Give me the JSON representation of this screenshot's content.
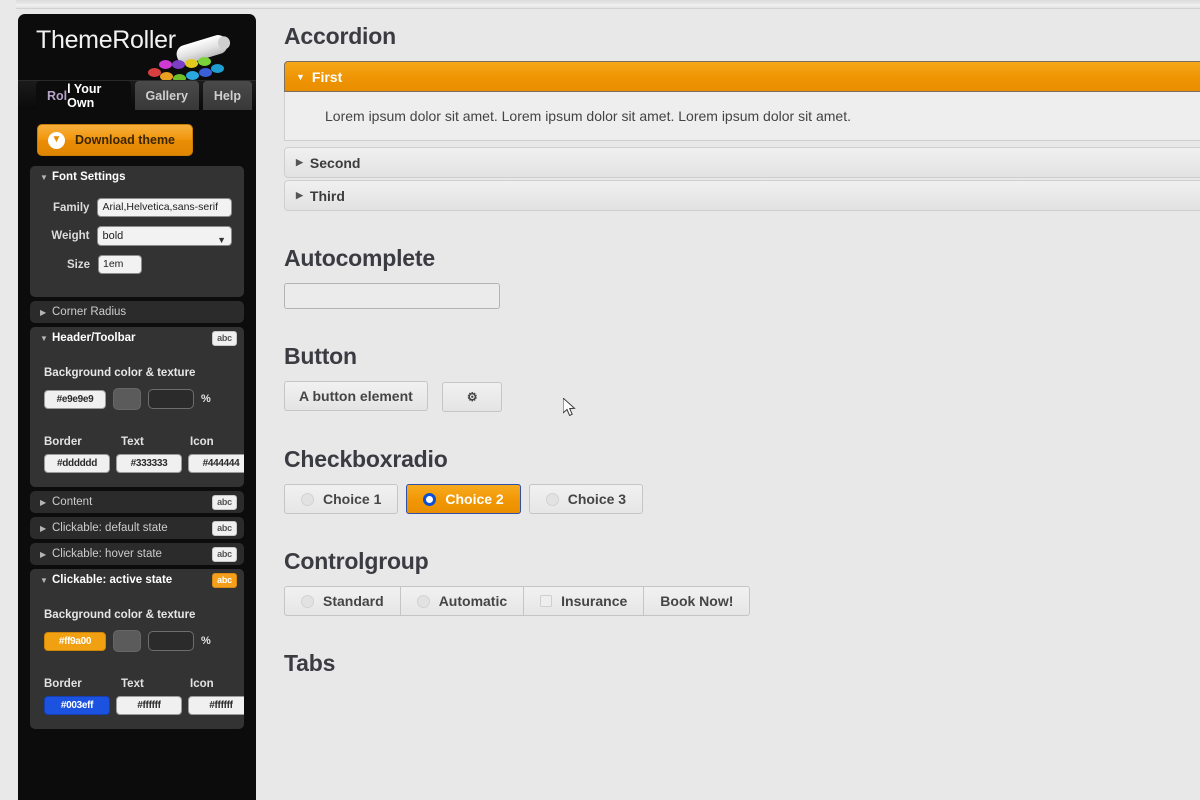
{
  "app": {
    "logo_text": "ThemeRoller",
    "logo_icon": "paint-roller-icon",
    "dot_colors": [
      "#d93f3f",
      "#e8a020",
      "#6fbf2a",
      "#7a3fc4",
      "#2aa8e0",
      "#e0c81e",
      "#3a5fd9",
      "#7ad13a",
      "#1f9fd1",
      "#cf3ad1"
    ]
  },
  "sidebar": {
    "tabs": [
      {
        "label": "Roll Your Own",
        "active": true
      },
      {
        "label": "Gallery",
        "active": false
      },
      {
        "label": "Help",
        "active": false
      }
    ],
    "download": {
      "label": "Download theme",
      "icon": "download-arrow-icon"
    },
    "font_settings": {
      "title": "Font Settings",
      "family_label": "Family",
      "family_value": "Arial,Helvetica,sans-serif",
      "weight_label": "Weight",
      "weight_value": "bold",
      "size_label": "Size",
      "size_value": "1em"
    },
    "corner_radius": {
      "title": "Corner Radius"
    },
    "header_toolbar": {
      "title": "Header/Toolbar",
      "badge": "abc",
      "bg_label": "Background color & texture",
      "bg_color": "#e9e9e9",
      "pct_value": "",
      "pct_sign": "%",
      "border_label": "Border",
      "text_label": "Text",
      "icon_label": "Icon",
      "border_color": "#dddddd",
      "text_color": "#333333",
      "icon_color": "#444444"
    },
    "content": {
      "title": "Content",
      "badge": "abc"
    },
    "clickable_default": {
      "title": "Clickable: default state",
      "badge": "abc"
    },
    "clickable_hover": {
      "title": "Clickable: hover state",
      "badge": "abc"
    },
    "clickable_active": {
      "title": "Clickable: active state",
      "badge": "abc",
      "bg_label": "Background color & texture",
      "bg_color": "#ff9a00",
      "pct_value": "",
      "pct_sign": "%",
      "border_label": "Border",
      "text_label": "Text",
      "icon_label": "Icon",
      "border_color": "#003eff",
      "text_color": "#ffffff",
      "icon_color": "#ffffff"
    }
  },
  "main": {
    "accordion": {
      "heading": "Accordion",
      "items": [
        {
          "label": "First",
          "active": true,
          "content": "Lorem ipsum dolor sit amet. Lorem ipsum dolor sit amet. Lorem ipsum dolor sit amet."
        },
        {
          "label": "Second",
          "active": false,
          "content": ""
        },
        {
          "label": "Third",
          "active": false,
          "content": ""
        }
      ]
    },
    "autocomplete": {
      "heading": "Autocomplete",
      "value": "",
      "placeholder": ""
    },
    "button": {
      "heading": "Button",
      "primary_label": "A button element",
      "icon_label": "⚙",
      "icon_name": "gear-icon"
    },
    "checkboxradio": {
      "heading": "Checkboxradio",
      "options": [
        {
          "label": "Choice 1",
          "checked": false
        },
        {
          "label": "Choice 2",
          "checked": true
        },
        {
          "label": "Choice 3",
          "checked": false
        }
      ]
    },
    "controlgroup": {
      "heading": "Controlgroup",
      "options": [
        {
          "label": "Standard",
          "type": "radio"
        },
        {
          "label": "Automatic",
          "type": "radio"
        },
        {
          "label": "Insurance",
          "type": "checkbox"
        },
        {
          "label": "Book Now!",
          "type": "button"
        }
      ]
    },
    "tabs": {
      "heading": "Tabs"
    }
  },
  "colors": {
    "accent_orange": "#ef9403",
    "accent_blue": "#003eff",
    "panel_dark": "#0c0c0c",
    "page_bg": "#e8e8e8"
  }
}
